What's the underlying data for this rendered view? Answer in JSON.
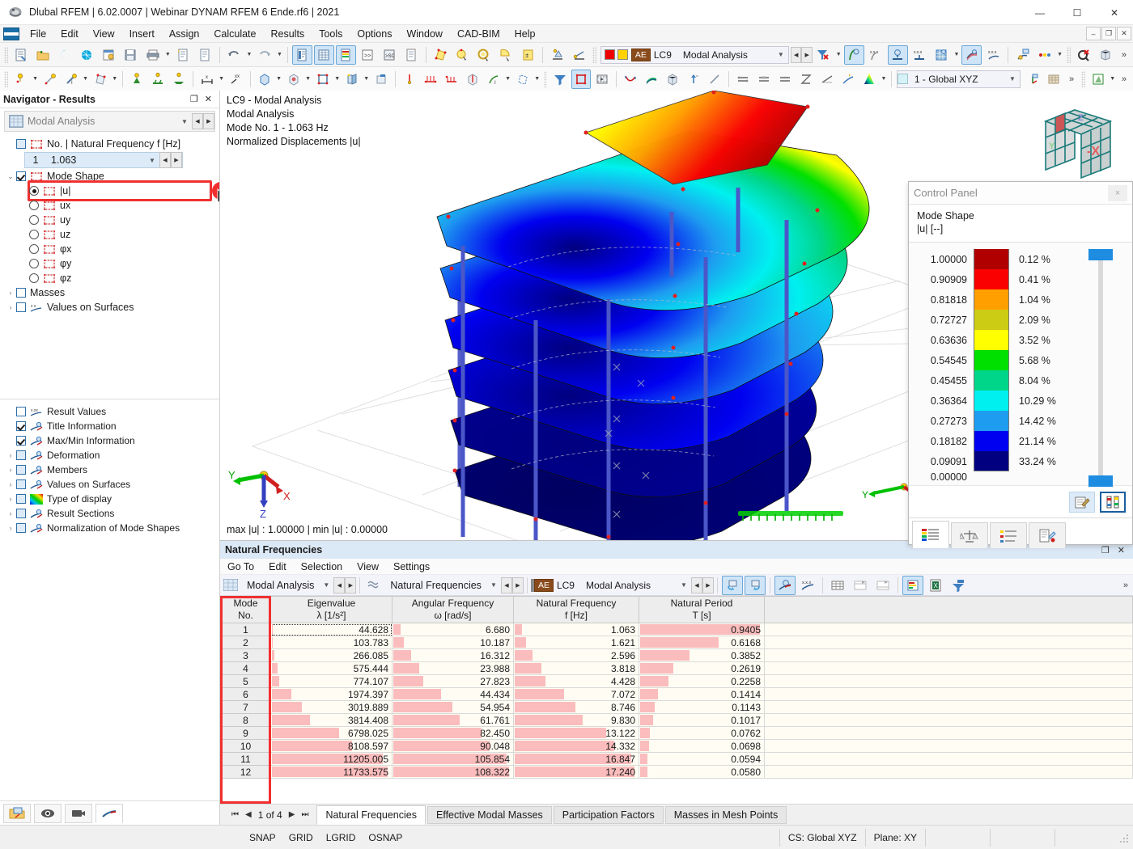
{
  "window": {
    "title": "Dlubal RFEM | 6.02.0007 | Webinar DYNAM RFEM 6 Ende.rf6 | 2021",
    "app_icon": "rfem-logo-icon",
    "minimize": "—",
    "maximize": "☐",
    "close": "✕"
  },
  "menubar": {
    "items": [
      "File",
      "Edit",
      "View",
      "Insert",
      "Assign",
      "Calculate",
      "Results",
      "Tools",
      "Options",
      "Window",
      "CAD-BIM",
      "Help"
    ],
    "mdi": [
      "–",
      "❐",
      "✕"
    ]
  },
  "toolbar_results": {
    "load_case_id": "LC9",
    "analysis": "Modal Analysis",
    "ae_badge": "AE",
    "color_red": "#ef0000",
    "color_yellow": "#ffd200"
  },
  "coord_system": {
    "label": "1 - Global XYZ"
  },
  "navigator": {
    "title": "Navigator - Results",
    "pin": "❐",
    "close": "✕",
    "combo_value": "Modal Analysis",
    "tree": {
      "freq_header": "No. | Natural Frequency f [Hz]",
      "selected_mode_no": "1",
      "selected_mode_freq": "1.063",
      "mode_shape": "Mode Shape",
      "components": [
        "|u|",
        "ux",
        "uy",
        "uz",
        "φx",
        "φy",
        "φz"
      ],
      "masses": "Masses",
      "values_on_surfaces": "Values on Surfaces"
    },
    "display_options": [
      {
        "label": "Result Values",
        "checked": false,
        "expandable": false,
        "icon": "xxx-values-icon"
      },
      {
        "label": "Title Information",
        "checked": true,
        "expandable": false,
        "icon": "display-icon"
      },
      {
        "label": "Max/Min Information",
        "checked": true,
        "expandable": false,
        "icon": "display-icon"
      },
      {
        "label": "Deformation",
        "checked": false,
        "expandable": true,
        "icon": "display-icon"
      },
      {
        "label": "Members",
        "checked": false,
        "expandable": true,
        "icon": "display-icon"
      },
      {
        "label": "Values on Surfaces",
        "checked": false,
        "expandable": true,
        "icon": "display-icon"
      },
      {
        "label": "Type of display",
        "checked": false,
        "expandable": true,
        "icon": "rainbow-icon"
      },
      {
        "label": "Result Sections",
        "checked": false,
        "expandable": true,
        "icon": "display-icon"
      },
      {
        "label": "Normalization of Mode Shapes",
        "checked": false,
        "expandable": true,
        "icon": "display-icon"
      }
    ],
    "bottom_tabs": [
      "project-navigator-icon",
      "eye-views-icon",
      "camera-icon",
      "results-icon"
    ]
  },
  "viewport": {
    "title_lines": [
      "LC9 - Modal Analysis",
      "Modal Analysis",
      "Mode No. 1 - 1.063 Hz",
      "Normalized Displacements |u|"
    ],
    "maxmin": "max |u| : 1.00000 | min |u| : 0.00000",
    "axes": {
      "x": "X",
      "y": "Y",
      "z": "Z"
    },
    "navcube_face": "-X"
  },
  "control_panel": {
    "title": "Control Panel",
    "close": "×",
    "subtitle_line1": "Mode Shape",
    "subtitle_line2": "|u| [--]",
    "legend": [
      {
        "value": "1.00000",
        "color": "#b00000",
        "percent": "0.12 %"
      },
      {
        "value": "0.90909",
        "color": "#fa0000",
        "percent": "0.41 %"
      },
      {
        "value": "0.81818",
        "color": "#ffa000",
        "percent": "1.04 %"
      },
      {
        "value": "0.72727",
        "color": "#cccc14",
        "percent": "2.09 %"
      },
      {
        "value": "0.63636",
        "color": "#ffff00",
        "percent": "3.52 %"
      },
      {
        "value": "0.54545",
        "color": "#00e000",
        "percent": "5.68 %"
      },
      {
        "value": "0.45455",
        "color": "#00d68a",
        "percent": "8.04 %"
      },
      {
        "value": "0.36364",
        "color": "#00f0f0",
        "percent": "10.29 %"
      },
      {
        "value": "0.27273",
        "color": "#1e9cf0",
        "percent": "14.42 %"
      },
      {
        "value": "0.18182",
        "color": "#0000f0",
        "percent": "21.14 %"
      },
      {
        "value": "0.09091",
        "color": "#000080",
        "percent": "33.24 %"
      },
      {
        "value": "0.00000",
        "color": null,
        "percent": null
      }
    ],
    "tools": [
      "edit-colors-icon",
      "legend-settings-icon"
    ],
    "tabs": [
      "color-scale-tab",
      "factors-tab",
      "display-properties-tab",
      "result-details-tab"
    ]
  },
  "table_window": {
    "title": "Natural Frequencies",
    "restore": "❐",
    "close": "✕",
    "menu": [
      "Go To",
      "Edit",
      "Selection",
      "View",
      "Settings"
    ],
    "combo_analysis": "Modal Analysis",
    "combo_table": "Natural Frequencies",
    "load_case_id": "LC9",
    "load_case_analysis": "Modal Analysis",
    "ae_badge": "AE",
    "pager": "1 of 4",
    "tabs": [
      "Natural Frequencies",
      "Effective Modal Masses",
      "Participation Factors",
      "Masses in Mesh Points"
    ],
    "active_tab": "Natural Frequencies"
  },
  "chart_data": {
    "type": "table",
    "title": "Natural Frequencies",
    "columns": [
      {
        "header": "Mode",
        "subheader": "No.",
        "key": "mode"
      },
      {
        "header": "Eigenvalue",
        "subheader": "λ [1/s²]",
        "key": "eigenvalue"
      },
      {
        "header": "Angular Frequency",
        "subheader": "ω [rad/s]",
        "key": "angular"
      },
      {
        "header": "Natural Frequency",
        "subheader": "f [Hz]",
        "key": "frequency"
      },
      {
        "header": "Natural Period",
        "subheader": "T [s]",
        "key": "period"
      }
    ],
    "rows": [
      {
        "mode": "1",
        "eigenvalue": "44.628",
        "angular": "6.680",
        "frequency": "1.063",
        "period": "0.9405"
      },
      {
        "mode": "2",
        "eigenvalue": "103.783",
        "angular": "10.187",
        "frequency": "1.621",
        "period": "0.6168"
      },
      {
        "mode": "3",
        "eigenvalue": "266.085",
        "angular": "16.312",
        "frequency": "2.596",
        "period": "0.3852"
      },
      {
        "mode": "4",
        "eigenvalue": "575.444",
        "angular": "23.988",
        "frequency": "3.818",
        "period": "0.2619"
      },
      {
        "mode": "5",
        "eigenvalue": "774.107",
        "angular": "27.823",
        "frequency": "4.428",
        "period": "0.2258"
      },
      {
        "mode": "6",
        "eigenvalue": "1974.397",
        "angular": "44.434",
        "frequency": "7.072",
        "period": "0.1414"
      },
      {
        "mode": "7",
        "eigenvalue": "3019.889",
        "angular": "54.954",
        "frequency": "8.746",
        "period": "0.1143"
      },
      {
        "mode": "8",
        "eigenvalue": "3814.408",
        "angular": "61.761",
        "frequency": "9.830",
        "period": "0.1017"
      },
      {
        "mode": "9",
        "eigenvalue": "6798.025",
        "angular": "82.450",
        "frequency": "13.122",
        "period": "0.0762"
      },
      {
        "mode": "10",
        "eigenvalue": "8108.597",
        "angular": "90.048",
        "frequency": "14.332",
        "period": "0.0698"
      },
      {
        "mode": "11",
        "eigenvalue": "11205.005",
        "angular": "105.854",
        "frequency": "16.847",
        "period": "0.0594"
      },
      {
        "mode": "12",
        "eigenvalue": "11733.575",
        "angular": "108.322",
        "frequency": "17.240",
        "period": "0.0580"
      }
    ],
    "bar_max": {
      "eigenvalue": 11733.575,
      "angular": 108.322,
      "frequency": 17.24,
      "period": 0.9405
    },
    "bar_color": "#fabcbc",
    "xlabel": "",
    "ylabel": ""
  },
  "statusbar": {
    "snap_buttons": [
      "SNAP",
      "GRID",
      "LGRID",
      "OSNAP"
    ],
    "cs": "CS: Global XYZ",
    "plane": "Plane: XY"
  }
}
